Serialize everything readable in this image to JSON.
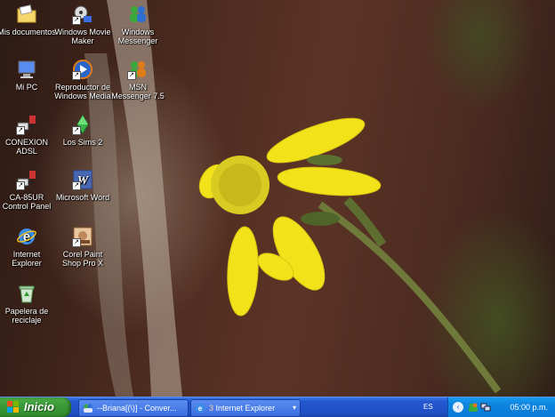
{
  "desktop": {
    "icons": [
      {
        "label": "Mis documentos",
        "icon": "folder-icon"
      },
      {
        "label": "Windows Movie Maker",
        "icon": "movie-maker-icon"
      },
      {
        "label": "Windows Messenger",
        "icon": "messenger-icon"
      },
      {
        "label": "Mi PC",
        "icon": "computer-icon"
      },
      {
        "label": "Reproductor de Windows Media",
        "icon": "media-player-icon"
      },
      {
        "label": "MSN Messenger 7.5",
        "icon": "msn-icon"
      },
      {
        "label": "CONEXION ADSL",
        "icon": "network-icon"
      },
      {
        "label": "Los Sims 2",
        "icon": "sims-icon"
      },
      {
        "label": "CA-85UR Control Panel",
        "icon": "control-panel-icon"
      },
      {
        "label": "Microsoft Word",
        "icon": "word-icon"
      },
      {
        "label": "Internet Explorer",
        "icon": "ie-icon"
      },
      {
        "label": "Corel Paint Shop Pro X",
        "icon": "paint-shop-icon"
      },
      {
        "label": "Papelera de reciclaje",
        "icon": "recycle-bin-icon"
      }
    ]
  },
  "taskbar": {
    "start_label": "Inicio",
    "tasks": [
      {
        "label": "--Briana[(\\)] - Conver..."
      },
      {
        "label": "Internet Explorer",
        "count": "3"
      }
    ],
    "tray": {
      "language": "ES",
      "clock": "05:00 p.m."
    }
  },
  "colors": {
    "taskbar": "#2457d1",
    "start": "#3c9a38",
    "tray": "#0f86e0"
  }
}
